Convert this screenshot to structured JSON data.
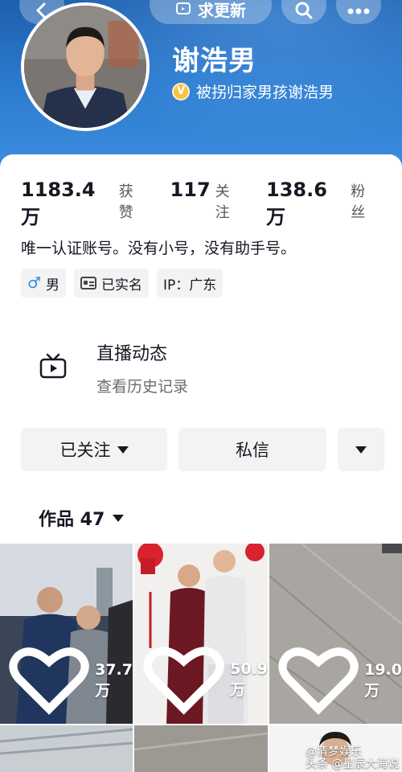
{
  "topbar": {
    "update_label": "求更新"
  },
  "profile": {
    "name": "谢浩男",
    "verification": "被拐归家男孩谢浩男"
  },
  "stats": [
    {
      "value": "1183.4万",
      "label": "获赞"
    },
    {
      "value": "117",
      "label": "关注"
    },
    {
      "value": "138.6万",
      "label": "粉丝"
    }
  ],
  "bio": "唯一认证账号。没有小号，没有助手号。",
  "tags": {
    "gender": "男",
    "realname": "已实名",
    "ip": "IP：广东"
  },
  "live": {
    "title": "直播动态",
    "subtitle": "查看历史记录"
  },
  "actions": {
    "follow_label": "已关注",
    "message_label": "私信"
  },
  "works": {
    "label": "作品 47"
  },
  "videos": [
    {
      "likes": "37.7万"
    },
    {
      "likes": "50.9万"
    },
    {
      "likes": "19.0万"
    }
  ],
  "watermark": {
    "line1": "@清梦娱乐",
    "line2": "头条 @星辰大海说"
  },
  "icons": {
    "back": "chevron-left-icon",
    "update": "update-icon",
    "search": "search-icon",
    "more": "more-icon",
    "verify": "verified-badge-icon",
    "male": "male-icon",
    "id_card": "id-card-icon",
    "tv": "tv-icon",
    "heart": "heart-icon"
  },
  "colors": {
    "header_blue": "#2a78cc",
    "verify_gold": "#f6c342",
    "male_blue": "#2d8de0"
  }
}
